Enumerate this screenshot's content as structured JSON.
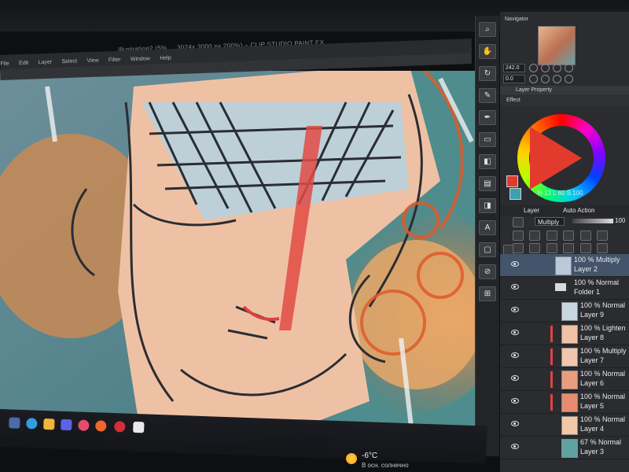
{
  "window": {
    "title": "Illustration2 (5% ... 3024x 3000 px 200%) – CLIP STUDIO PAINT EX",
    "menus": [
      "File",
      "Edit",
      "Layer",
      "Select",
      "View",
      "Filter",
      "Window",
      "Help"
    ]
  },
  "tools": [
    "zoom-icon",
    "hand-icon",
    "rotate-icon",
    "brush-icon",
    "pen-icon",
    "eraser-icon",
    "fill-icon",
    "layer-icon",
    "gradient-icon",
    "text-icon",
    "frame-icon",
    "eyedropper-icon",
    "ruler-icon"
  ],
  "navigator": {
    "title": "Navigator",
    "zoom": "242.0",
    "rotation": "0.0"
  },
  "layer_property": {
    "title": "Layer Property",
    "effect_label": "Effect"
  },
  "color": {
    "main": "#e23b2e",
    "sub": "#3ba1b0",
    "h": "13",
    "s_label": "L",
    "s": "60",
    "v_label": "S",
    "v": "100",
    "h_label": "H"
  },
  "tabs": {
    "layer": "Layer",
    "auto_action": "Auto Action"
  },
  "layer_controls": {
    "blend_mode": "Multiply",
    "opacity": "100"
  },
  "layers": [
    {
      "mode": "100 % Multiply",
      "name": "Layer 2",
      "selected": true,
      "clip": false,
      "type": "raster",
      "thumb": "#b9c9d9"
    },
    {
      "mode": "100 % Normal",
      "name": "Folder 1",
      "selected": false,
      "clip": false,
      "type": "folder",
      "thumb": ""
    },
    {
      "mode": "100 % Normal",
      "name": "Layer 9",
      "selected": false,
      "clip": false,
      "type": "raster",
      "thumb": "#c8d6e0"
    },
    {
      "mode": "100 % Lighten",
      "name": "Layer 8",
      "selected": false,
      "clip": true,
      "type": "raster",
      "thumb": "#f0c2a6"
    },
    {
      "mode": "100 % Multiply",
      "name": "Layer 7",
      "selected": false,
      "clip": true,
      "type": "raster",
      "thumb": "#f1c5ae"
    },
    {
      "mode": "100 % Normal",
      "name": "Layer 6",
      "selected": false,
      "clip": true,
      "type": "raster",
      "thumb": "#ea9c7f"
    },
    {
      "mode": "100 % Normal",
      "name": "Layer 5",
      "selected": false,
      "clip": true,
      "type": "raster",
      "thumb": "#e88b6f"
    },
    {
      "mode": "100 % Normal",
      "name": "Layer 4",
      "selected": false,
      "clip": false,
      "type": "raster",
      "thumb": "#f2c9a8"
    },
    {
      "mode": "67 % Normal",
      "name": "Layer 3",
      "selected": false,
      "clip": false,
      "type": "raster",
      "thumb": "#5fa39f"
    }
  ],
  "taskbar": {
    "weather_temp": "-6°C",
    "weather_desc": "В осн. солнечно"
  }
}
